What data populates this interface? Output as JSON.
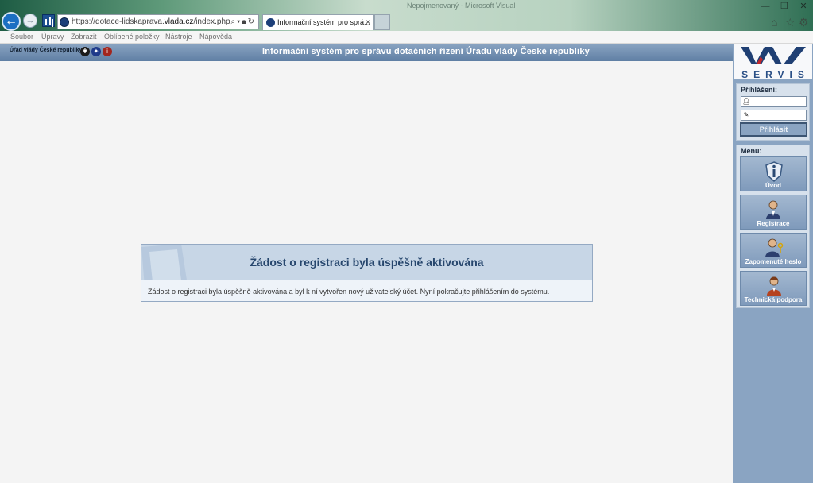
{
  "browser": {
    "title_faint": "Nepojmenovaný - Microsoft Visual",
    "address_prefix": "https://dotace-lidskaprava.",
    "address_domain": "vlada.cz",
    "address_suffix": "/index.php",
    "tab_title": "Informační systém pro sprá...",
    "tab_close": "×",
    "window_controls": [
      "—",
      "❐",
      "✕"
    ],
    "menu": [
      "Soubor",
      "Úpravy",
      "Zobrazit",
      "Oblíbené položky",
      "Nástroje",
      "Nápověda"
    ]
  },
  "header": {
    "org": "Úřad vlády České republiky",
    "title": "Informační systém pro správu dotačních řízení Úřadu vlády České republiky"
  },
  "sidebar": {
    "logo_text": "SERVIS",
    "login": {
      "title": "Přihlášení:",
      "username_value": "",
      "password_value": "",
      "button": "Přihlásit"
    },
    "menu_title": "Menu:",
    "menu_items": [
      {
        "label": "Úvod",
        "icon": "info-shield-icon"
      },
      {
        "label": "Registrace",
        "icon": "person-icon"
      },
      {
        "label": "Zapomenuté heslo",
        "icon": "person-key-icon"
      },
      {
        "label": "Technická podpora",
        "icon": "support-person-icon"
      }
    ]
  },
  "message": {
    "title": "Žádost o registraci byla úspěšně aktivována",
    "body": "Žádost o registraci byla úspěšně aktivována a byl k ní vytvořen nový uživatelský účet. Nyní pokračujte přihlášením do systému."
  },
  "colors": {
    "header_bar": "#6f8db0",
    "sidebar": "#8aa4c2",
    "message_head": "#c7d6e6",
    "message_title": "#26466d"
  }
}
